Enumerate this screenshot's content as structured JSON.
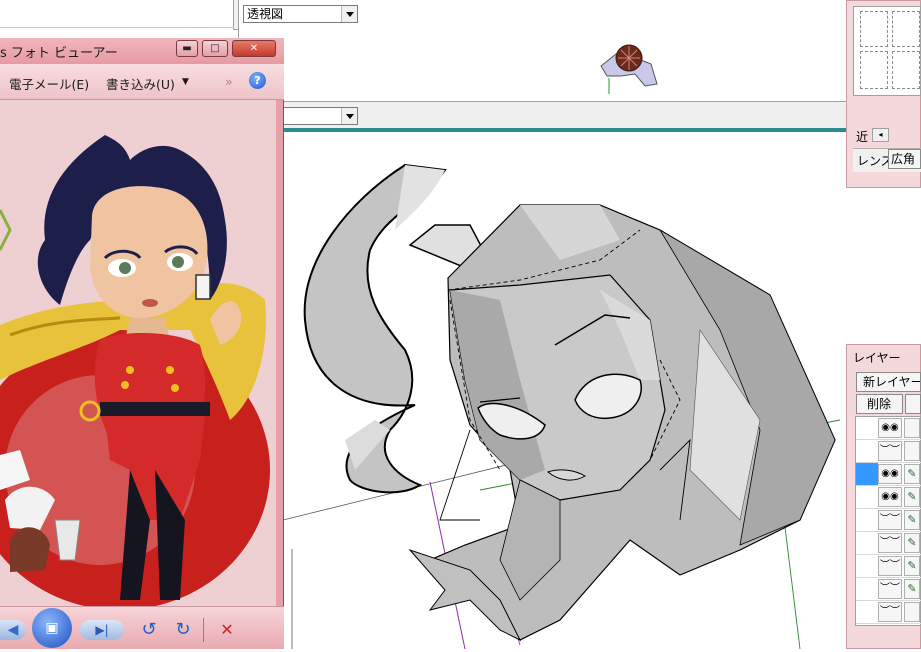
{
  "modeler": {
    "view_select": {
      "value": "透視図"
    },
    "view2_select": {
      "value": ""
    },
    "camera_panel": {
      "near_label": "近",
      "scroll_arrow": "◂",
      "lens_label": "レンズ",
      "lens_button": "広角"
    },
    "layer_panel": {
      "title": "レイヤー",
      "new_button": "新レイヤー",
      "delete_button": "削除",
      "rows": [
        {
          "visible_icon": "eyes-open",
          "edit": false,
          "selected": false
        },
        {
          "visible_icon": "eyes-closed",
          "edit": false,
          "selected": false
        },
        {
          "visible_icon": "eyes-open",
          "edit": true,
          "selected": true
        },
        {
          "visible_icon": "eyes-open",
          "edit": true,
          "selected": false
        },
        {
          "visible_icon": "eyes-closed",
          "edit": true,
          "selected": false
        },
        {
          "visible_icon": "eyes-closed",
          "edit": true,
          "selected": false
        },
        {
          "visible_icon": "eyes-closed",
          "edit": true,
          "selected": false
        },
        {
          "visible_icon": "eyes-closed",
          "edit": true,
          "selected": false
        },
        {
          "visible_icon": "eyes-closed",
          "edit": false,
          "selected": false
        }
      ]
    }
  },
  "photo_viewer": {
    "title": "s フォト ビューアー",
    "window_buttons": {
      "minimize": "▬",
      "maximize": "□",
      "close": "✕"
    },
    "menu": {
      "email": "電子メール(E)",
      "burn": "書き込み(U)",
      "burn_arrow": "▼",
      "overflow": "»",
      "help": "?"
    },
    "controls": {
      "prev": "◀",
      "slideshow": "▣",
      "next": "▶|",
      "rotate_ccw": "↺",
      "rotate_cw": "↻",
      "delete": "✕"
    }
  },
  "colors": {
    "viewer_chrome": "#e8a0a8",
    "teal_rule": "#2a8c8c",
    "layer_selected": "#3399ff",
    "model_fill": "#c4c4c4"
  }
}
